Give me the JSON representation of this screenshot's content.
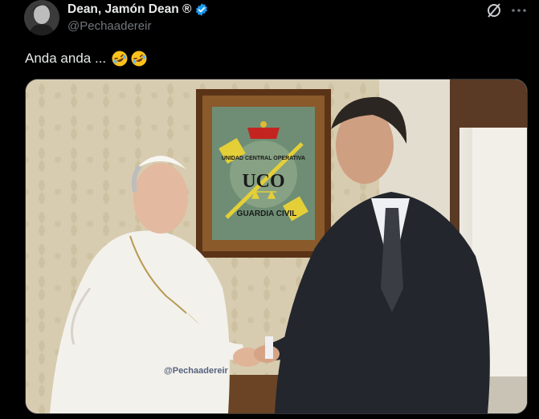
{
  "post": {
    "display_name": "Dean, Jamón Dean ®",
    "handle": "@Pechaadereir",
    "text": "Anda anda ...",
    "emojis": [
      "rolling-on-floor-laughing-emoji",
      "rolling-on-floor-laughing-emoji"
    ]
  },
  "media": {
    "frame_text": {
      "acronym": "UCO",
      "arc_text": "UNIDAD CENTRAL OPERATIVA",
      "bottom_text": "GUARDIA CIVIL"
    },
    "watermark": "@Pechaadereir"
  },
  "colors": {
    "verified": "#1d9bf0",
    "handle": "#71767b",
    "text": "#e7e9ea",
    "background": "#000000"
  },
  "icons": [
    "verified-badge-icon",
    "grok-icon",
    "more-icon"
  ]
}
